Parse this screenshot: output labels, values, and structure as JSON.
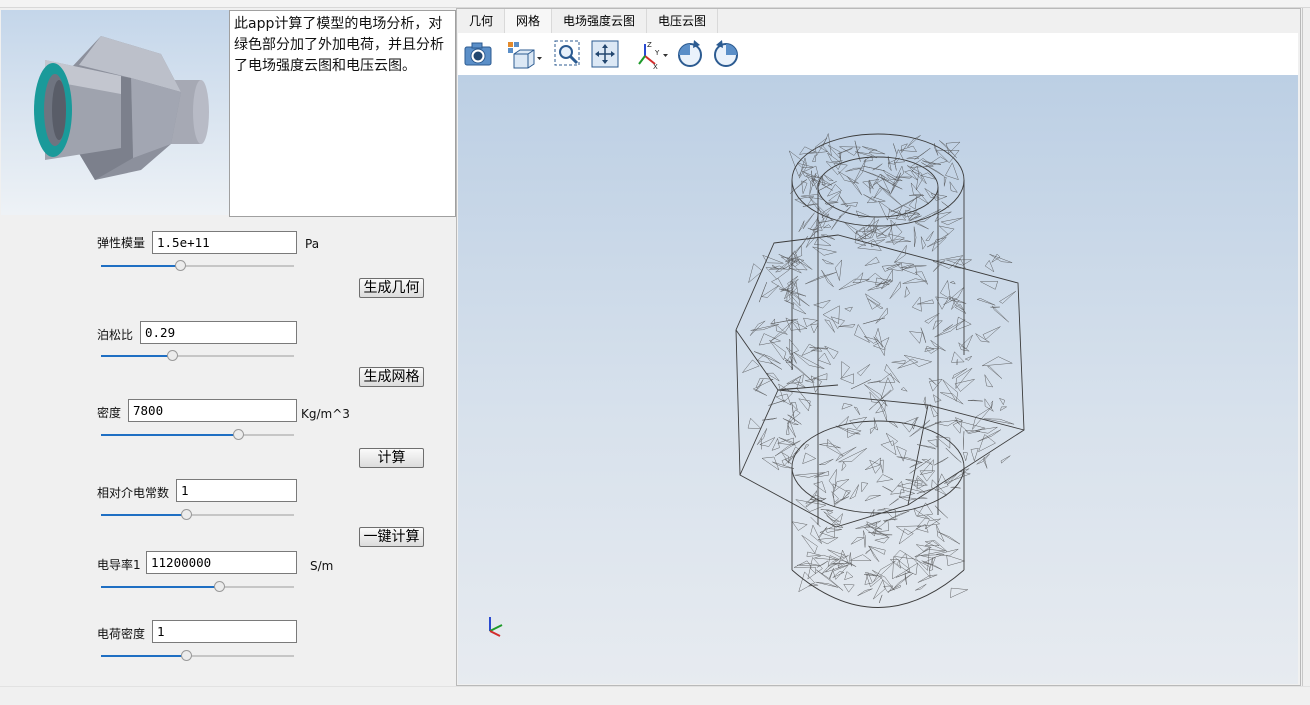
{
  "description": "此app计算了模型的电场分析，对绿色部分加了外加电荷，并且分析了电场强度云图和电压云图。",
  "params": {
    "elastic_modulus": {
      "label": "弹性模量",
      "value": "1.5e+11",
      "unit": "Pa",
      "slider": 0.41
    },
    "poisson_ratio": {
      "label": "泊松比",
      "value": "0.29",
      "slider": 0.37
    },
    "density": {
      "label": "密度",
      "value": "7800",
      "unit": "Kg/m^3",
      "slider": 0.71
    },
    "permittivity": {
      "label": "相对介电常数",
      "value": "1",
      "slider": 0.44
    },
    "conductivity": {
      "label": "电导率1",
      "value": "11200000",
      "unit": "S/m",
      "slider": 0.61
    },
    "charge_density": {
      "label": "电荷密度",
      "value": "1",
      "slider": 0.44
    }
  },
  "buttons": {
    "generate_geometry": "生成几何",
    "generate_mesh": "生成网格",
    "compute": "计算",
    "one_click_compute": "一键计算"
  },
  "tabs": [
    "几何",
    "网格",
    "电场强度云图",
    "电压云图"
  ],
  "active_tab": "网格",
  "toolbar_icons": [
    "camera-icon",
    "view-cube-icon",
    "zoom-box-icon",
    "zoom-extents-icon",
    "axes-orient-icon",
    "rotate-ccw-icon",
    "rotate-cw-icon"
  ],
  "colors": {
    "accent_slider": "#1f6fc3",
    "teal_ring": "#1a9a9a",
    "mesh_line": "#3c3c3c",
    "axis_x": "#d22c2c",
    "axis_y": "#1e9a2a",
    "axis_z": "#2a4ad0"
  }
}
